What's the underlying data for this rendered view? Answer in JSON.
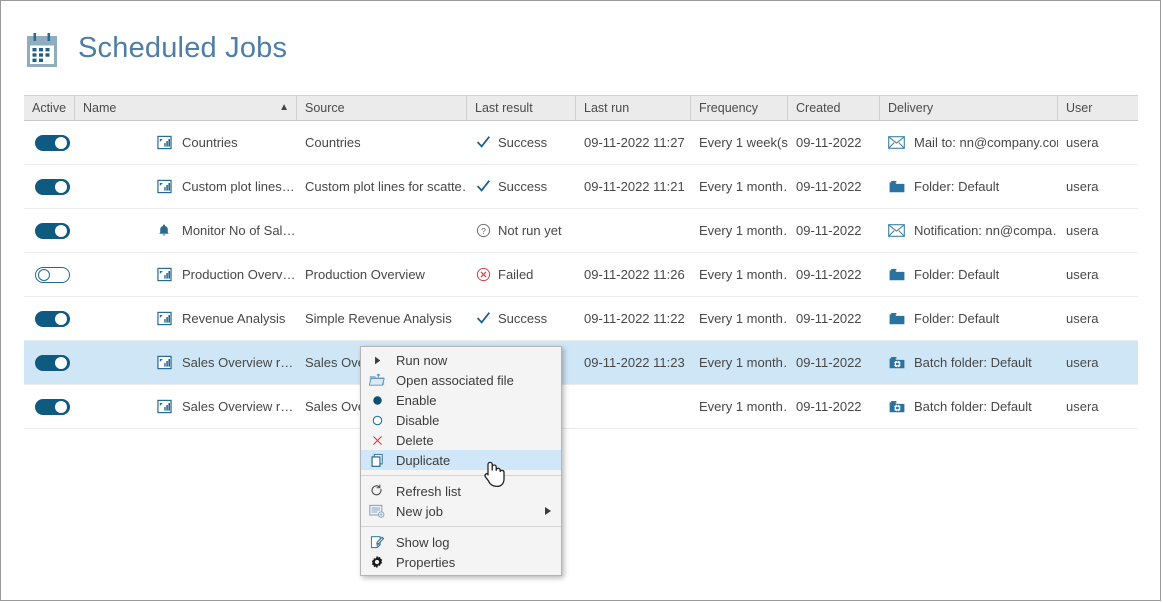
{
  "page": {
    "title": "Scheduled Jobs",
    "icon": "calendar-icon",
    "accent_color": "#4d7ea8",
    "toggle_on_color": "#0e5a80",
    "selected_row_color": "#cfe6f7"
  },
  "table": {
    "sort_column": "Name",
    "sort_direction": "ascending",
    "sort_arrow": "▲",
    "columns": [
      {
        "key": "active",
        "label": "Active"
      },
      {
        "key": "name",
        "label": "Name"
      },
      {
        "key": "source",
        "label": "Source"
      },
      {
        "key": "last_result",
        "label": "Last result"
      },
      {
        "key": "last_run",
        "label": "Last run"
      },
      {
        "key": "frequency",
        "label": "Frequency"
      },
      {
        "key": "created",
        "label": "Created"
      },
      {
        "key": "delivery",
        "label": "Delivery"
      },
      {
        "key": "user",
        "label": "User"
      }
    ],
    "rows": [
      {
        "active": true,
        "name": "Countries",
        "name_icon": "chart-report-icon",
        "source": "Countries",
        "last_result": "Success",
        "last_result_icon": "checkmark-icon",
        "last_run": "09-11-2022 11:27",
        "frequency": "Every 1 week(s…",
        "created": "09-11-2022",
        "delivery": "Mail to: nn@company.com",
        "delivery_icon": "envelope-icon",
        "user": "usera",
        "selected": false
      },
      {
        "active": true,
        "name": "Custom plot lines for scatter and …",
        "name_icon": "chart-report-icon",
        "source": "Custom plot lines for scatte…",
        "last_result": "Success",
        "last_result_icon": "checkmark-icon",
        "last_run": "09-11-2022 11:21",
        "frequency": "Every 1 month…",
        "created": "09-11-2022",
        "delivery": "Folder: Default",
        "delivery_icon": "folder-icon",
        "user": "usera",
        "selected": false
      },
      {
        "active": true,
        "name": "Monitor No of Sales per Salesper…",
        "name_icon": "bell-icon",
        "source": "",
        "last_result": "Not run yet",
        "last_result_icon": "question-circle-icon",
        "last_run": "",
        "frequency": "Every 1 month…",
        "created": "09-11-2022",
        "delivery": "Notification: nn@compa…",
        "delivery_icon": "envelope-icon",
        "user": "usera",
        "selected": false
      },
      {
        "active": false,
        "name": "Production Overview",
        "name_icon": "chart-report-icon",
        "source": "Production Overview",
        "last_result": "Failed",
        "last_result_icon": "error-circle-icon",
        "last_run": "09-11-2022 11:26",
        "frequency": "Every 1 month…",
        "created": "09-11-2022",
        "delivery": "Folder: Default",
        "delivery_icon": "folder-icon",
        "user": "usera",
        "selected": false
      },
      {
        "active": true,
        "name": "Revenue Analysis",
        "name_icon": "chart-report-icon",
        "source": "Simple Revenue Analysis",
        "last_result": "Success",
        "last_result_icon": "checkmark-icon",
        "last_run": "09-11-2022 11:22",
        "frequency": "Every 1 month…",
        "created": "09-11-2022",
        "delivery": "Folder: Default",
        "delivery_icon": "folder-icon",
        "user": "usera",
        "selected": false
      },
      {
        "active": true,
        "name": "Sales Overview report",
        "name_icon": "chart-report-icon",
        "source": "Sales Over…",
        "last_result": "",
        "last_result_icon": "",
        "last_run": "09-11-2022 11:23",
        "frequency": "Every 1 month…",
        "created": "09-11-2022",
        "delivery": "Batch folder: Default",
        "delivery_icon": "batch-folder-icon",
        "user": "usera",
        "selected": true
      },
      {
        "active": true,
        "name": "Sales Overview report - Copy",
        "name_icon": "chart-report-icon",
        "source": "Sales Over…",
        "last_result": "",
        "last_result_icon": "",
        "last_run": "",
        "frequency": "Every 1 month…",
        "created": "09-11-2022",
        "delivery": "Batch folder: Default",
        "delivery_icon": "batch-folder-icon",
        "user": "usera",
        "selected": false
      }
    ]
  },
  "context_menu": {
    "groups": [
      {
        "items": [
          {
            "label": "Run now",
            "icon": "play-icon",
            "highlighted": false,
            "submenu": false
          },
          {
            "label": "Open associated file",
            "icon": "open-folder-icon",
            "highlighted": false,
            "submenu": false
          },
          {
            "label": "Enable",
            "icon": "filled-circle-icon",
            "highlighted": false,
            "submenu": false
          },
          {
            "label": "Disable",
            "icon": "empty-circle-icon",
            "highlighted": false,
            "submenu": false
          },
          {
            "label": "Delete",
            "icon": "x-icon",
            "highlighted": false,
            "submenu": false
          },
          {
            "label": "Duplicate",
            "icon": "copy-icon",
            "highlighted": true,
            "submenu": false
          }
        ]
      },
      {
        "items": [
          {
            "label": "Refresh list",
            "icon": "refresh-icon",
            "highlighted": false,
            "submenu": false
          },
          {
            "label": "New job",
            "icon": "new-job-icon",
            "highlighted": false,
            "submenu": true
          }
        ]
      },
      {
        "items": [
          {
            "label": "Show log",
            "icon": "log-icon",
            "highlighted": false,
            "submenu": false
          },
          {
            "label": "Properties",
            "icon": "gear-icon",
            "highlighted": false,
            "submenu": false
          }
        ]
      }
    ]
  }
}
